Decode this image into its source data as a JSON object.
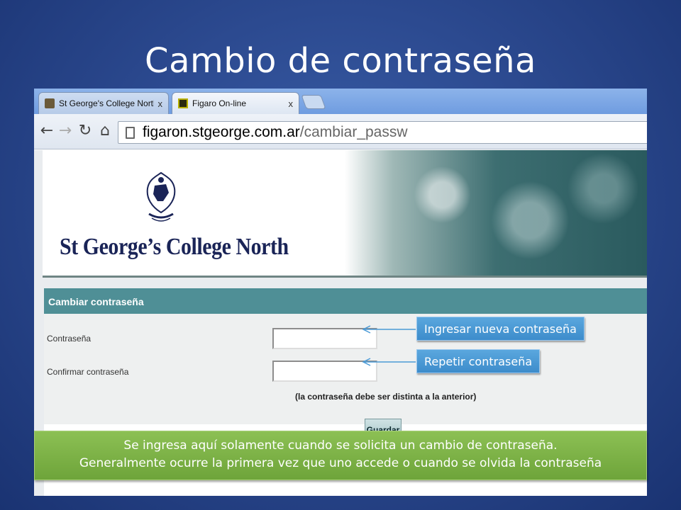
{
  "slide": {
    "title": "Cambio de contraseña"
  },
  "browser": {
    "tabs": [
      {
        "label": "St George's College North - (",
        "close": "x"
      },
      {
        "label": "Figaro On-line",
        "close": "x"
      }
    ],
    "url_host": "figaron.stgeorge.com.ar",
    "url_path": "/cambiar_passw"
  },
  "site": {
    "school_name": "St George’s College North"
  },
  "form": {
    "title": "Cambiar contraseña",
    "password_label": "Contraseña",
    "confirm_label": "Confirmar contraseña",
    "password_value": "",
    "confirm_value": "",
    "hint": "(la contraseña debe ser distinta a la anterior)",
    "save_label": "Guardar"
  },
  "callouts": {
    "new_password": "Ingresar nueva contraseña",
    "repeat_password": "Repetir contraseña"
  },
  "banner": {
    "line1": "Se ingresa aquí solamente cuando se solicita un cambio de contraseña.",
    "line2": "Generalmente ocurre la primera vez que uno accede o cuando se olvida la contraseña"
  },
  "colors": {
    "slide_bg": "#2c4a90",
    "form_header": "#4f8f96",
    "callout_blue": "#4a9ad6",
    "banner_green": "#7bb347"
  },
  "icons": [
    "back-icon",
    "forward-icon",
    "reload-icon",
    "home-icon",
    "page-icon"
  ]
}
